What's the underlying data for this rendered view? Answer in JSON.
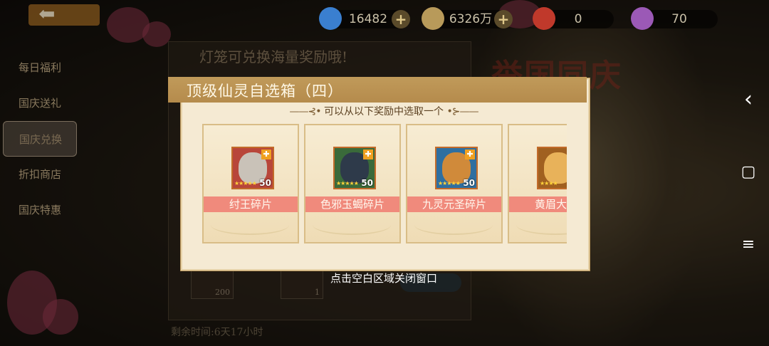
{
  "topbar": {
    "back_icon": "arrow-left-icon",
    "gems": "16482",
    "coins": "6326万",
    "lanterns": "0",
    "balloons": "70",
    "plus": "+"
  },
  "menu": {
    "items": [
      {
        "label": "每日福利"
      },
      {
        "label": "国庆送礼"
      },
      {
        "label": "国庆兑换"
      },
      {
        "label": "折扣商店"
      },
      {
        "label": "国庆特惠"
      }
    ]
  },
  "background": {
    "panel_title": "灯笼可兑换海量奖励哦!",
    "banner_text": "举国同庆",
    "item_counts": [
      "200",
      "1"
    ],
    "remaining_time": "剩余时间:6天17小时"
  },
  "modal": {
    "title": "顶级仙灵自选箱（四）",
    "subtitle": "可以从以下奖励中选取一个",
    "subtitle_deco_left": "——⊰•",
    "subtitle_deco_right": "•⊱——",
    "cards": [
      {
        "name": "纣王碎片",
        "count": "50",
        "stars": "★★★★★",
        "portrait_color": "#c9c2b8",
        "bg_color": "#b8463a"
      },
      {
        "name": "色邪玉蝎碎片",
        "count": "50",
        "stars": "★★★★★",
        "portrait_color": "#2e3a4a",
        "bg_color": "#3a6a3a"
      },
      {
        "name": "九灵元圣碎片",
        "count": "50",
        "stars": "★★★★★",
        "portrait_color": "#d08a3a",
        "bg_color": "#2f6fa0"
      },
      {
        "name": "黄眉大王",
        "count": "",
        "stars": "★★★★",
        "portrait_color": "#e8b25a",
        "bg_color": "#a06020"
      }
    ]
  },
  "close_hint": "点击空白区域关闭窗口",
  "nav": {
    "back": "‹",
    "home": "▢",
    "menu": "≡"
  },
  "colors": {
    "modal_bg": "#f5ead3",
    "title_bar": "#b58b4c",
    "name_tag": "#f08a7c"
  }
}
